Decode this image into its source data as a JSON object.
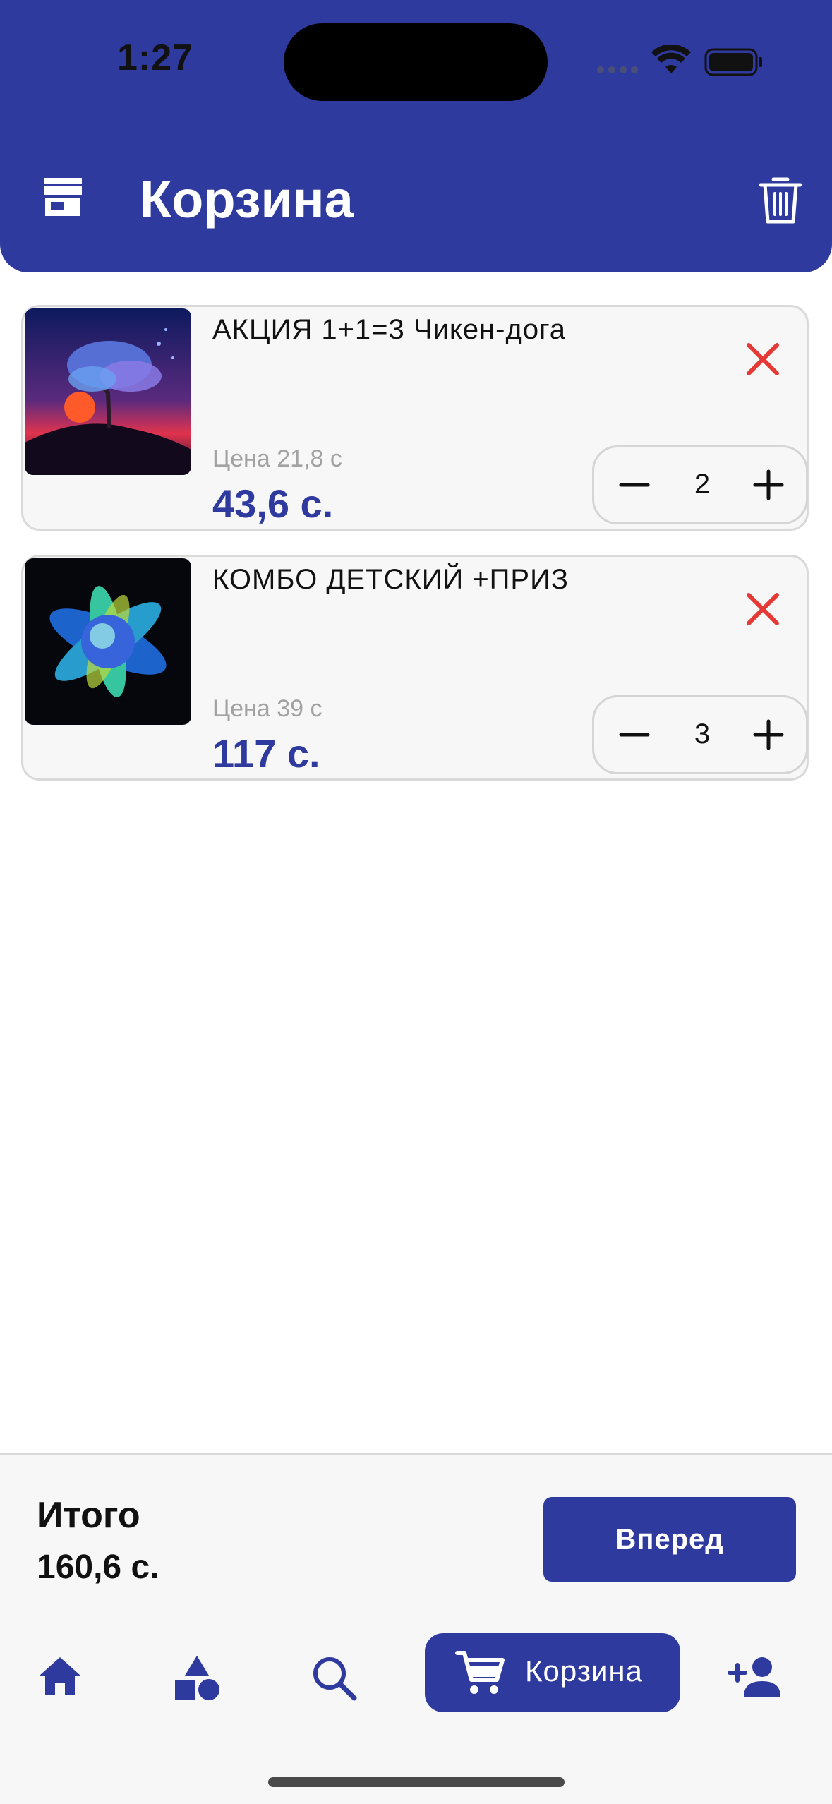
{
  "status_bar": {
    "time": "1:27"
  },
  "header": {
    "title": "Корзина"
  },
  "cart": {
    "items": [
      {
        "name": "АКЦИЯ 1+1=3 Чикен-дога",
        "unit_price": "Цена 21,8 с",
        "total": "43,6 с.",
        "quantity": "2"
      },
      {
        "name": "КОМБО ДЕТСКИЙ +ПРИЗ",
        "unit_price": "Цена 39 с",
        "total": "117 с.",
        "quantity": "3"
      }
    ]
  },
  "summary": {
    "total_label": "Итого",
    "total_value": "160,6 с.",
    "next_label": "Вперед"
  },
  "bottom_nav": {
    "items": [
      {
        "icon": "home-icon"
      },
      {
        "icon": "categories-icon"
      },
      {
        "icon": "search-icon"
      },
      {
        "icon": "cart-icon",
        "label": "Корзина",
        "active": true
      },
      {
        "icon": "add-user-icon"
      }
    ]
  },
  "colors": {
    "primary": "#2f3a9e",
    "remove": "#e53935",
    "card_bg": "#f7f7f7"
  }
}
